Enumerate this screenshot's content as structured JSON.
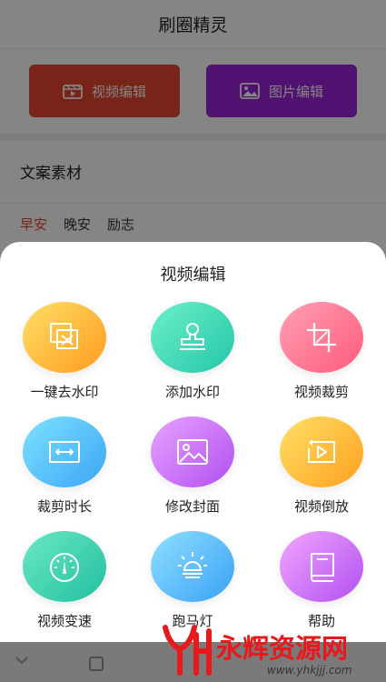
{
  "app": {
    "title": "刷圈精灵",
    "video_edit_button": "视频编辑",
    "image_edit_button": "图片编辑",
    "section_title": "文案素材",
    "tabs": [
      "早安",
      "晚安",
      "励志"
    ]
  },
  "sheet": {
    "title": "视频编辑",
    "tools": [
      {
        "label": "一键去水印",
        "icon": "watermark-remove-icon",
        "colors": [
          "#ffe066",
          "#ff9a1f"
        ]
      },
      {
        "label": "添加水印",
        "icon": "stamp-icon",
        "colors": [
          "#6ef0c8",
          "#23c6a9"
        ]
      },
      {
        "label": "视频裁剪",
        "icon": "crop-icon",
        "colors": [
          "#ff9fb2",
          "#ff5c7d"
        ]
      },
      {
        "label": "裁剪时长",
        "icon": "trim-duration-icon",
        "colors": [
          "#7ee1ff",
          "#3ba6f5"
        ]
      },
      {
        "label": "修改封面",
        "icon": "image-cover-icon",
        "colors": [
          "#e7a3ff",
          "#b24ff0"
        ]
      },
      {
        "label": "视频倒放",
        "icon": "reverse-play-icon",
        "colors": [
          "#ffe066",
          "#ffa01f"
        ]
      },
      {
        "label": "视频变速",
        "icon": "speedometer-icon",
        "colors": [
          "#69e9c2",
          "#22bfa1"
        ]
      },
      {
        "label": "跑马灯",
        "icon": "lamp-icon",
        "colors": [
          "#8fe0ff",
          "#3aa1f6"
        ]
      },
      {
        "label": "帮助",
        "icon": "book-icon",
        "colors": [
          "#f3a6ff",
          "#b14ff0"
        ]
      }
    ]
  },
  "watermark": {
    "text": "永辉资源网",
    "url": "www.yhkjjj.com"
  },
  "colors": {
    "accent_red": "#e8462e",
    "accent_purple": "#9a22d8",
    "watermark_red": "#e8181b"
  }
}
